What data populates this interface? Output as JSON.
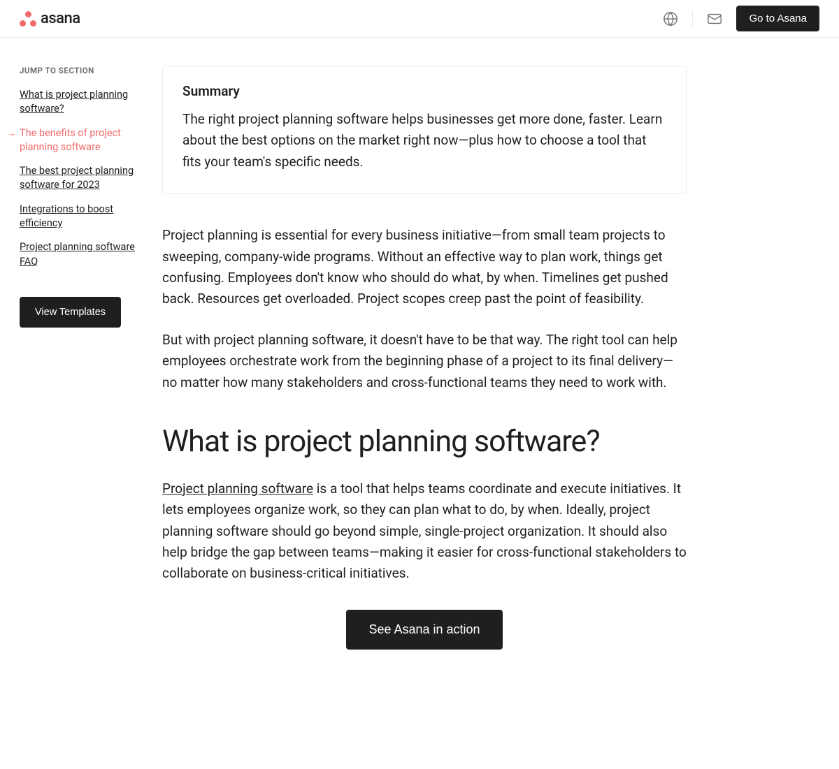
{
  "header": {
    "brand": "asana",
    "go_to_asana": "Go to Asana"
  },
  "sidebar": {
    "jump_title": "JUMP TO SECTION",
    "items": [
      {
        "label": "What is project planning software?",
        "active": false
      },
      {
        "label": "The benefits of project planning software",
        "active": true
      },
      {
        "label": "The best project planning software for 2023",
        "active": false
      },
      {
        "label": "Integrations to boost efficiency",
        "active": false
      },
      {
        "label": "Project planning software FAQ",
        "active": false
      }
    ],
    "view_templates": "View Templates"
  },
  "content": {
    "summary_title": "Summary",
    "summary_text": "The right project planning software helps businesses get more done, faster. Learn about the best options on the market right now—plus how to choose a tool that fits your team's specific needs.",
    "para1": "Project planning is essential for every business initiative—from small team projects to sweeping, company-wide programs. Without an effective way to plan work, things get confusing. Employees don't know who should do what, by when. Timelines get pushed back. Resources get overloaded. Project scopes creep past the point of feasibility.",
    "para2": "But with project planning software, it doesn't have to be that way. The right tool can help employees orchestrate work from the beginning phase of a project to its final delivery—no matter how many stakeholders and cross-functional teams they need to work with.",
    "heading1": "What is project planning software?",
    "link1": "Project planning software",
    "para3_rest": " is a tool that helps teams coordinate and execute initiatives. It lets employees organize work, so they can plan what to do, by when. Ideally, project planning software should go beyond simple, single-project organization. It should also help bridge the gap between teams—making it easier for cross-functional stakeholders to collaborate on business-critical initiatives.",
    "cta": "See Asana in action"
  }
}
